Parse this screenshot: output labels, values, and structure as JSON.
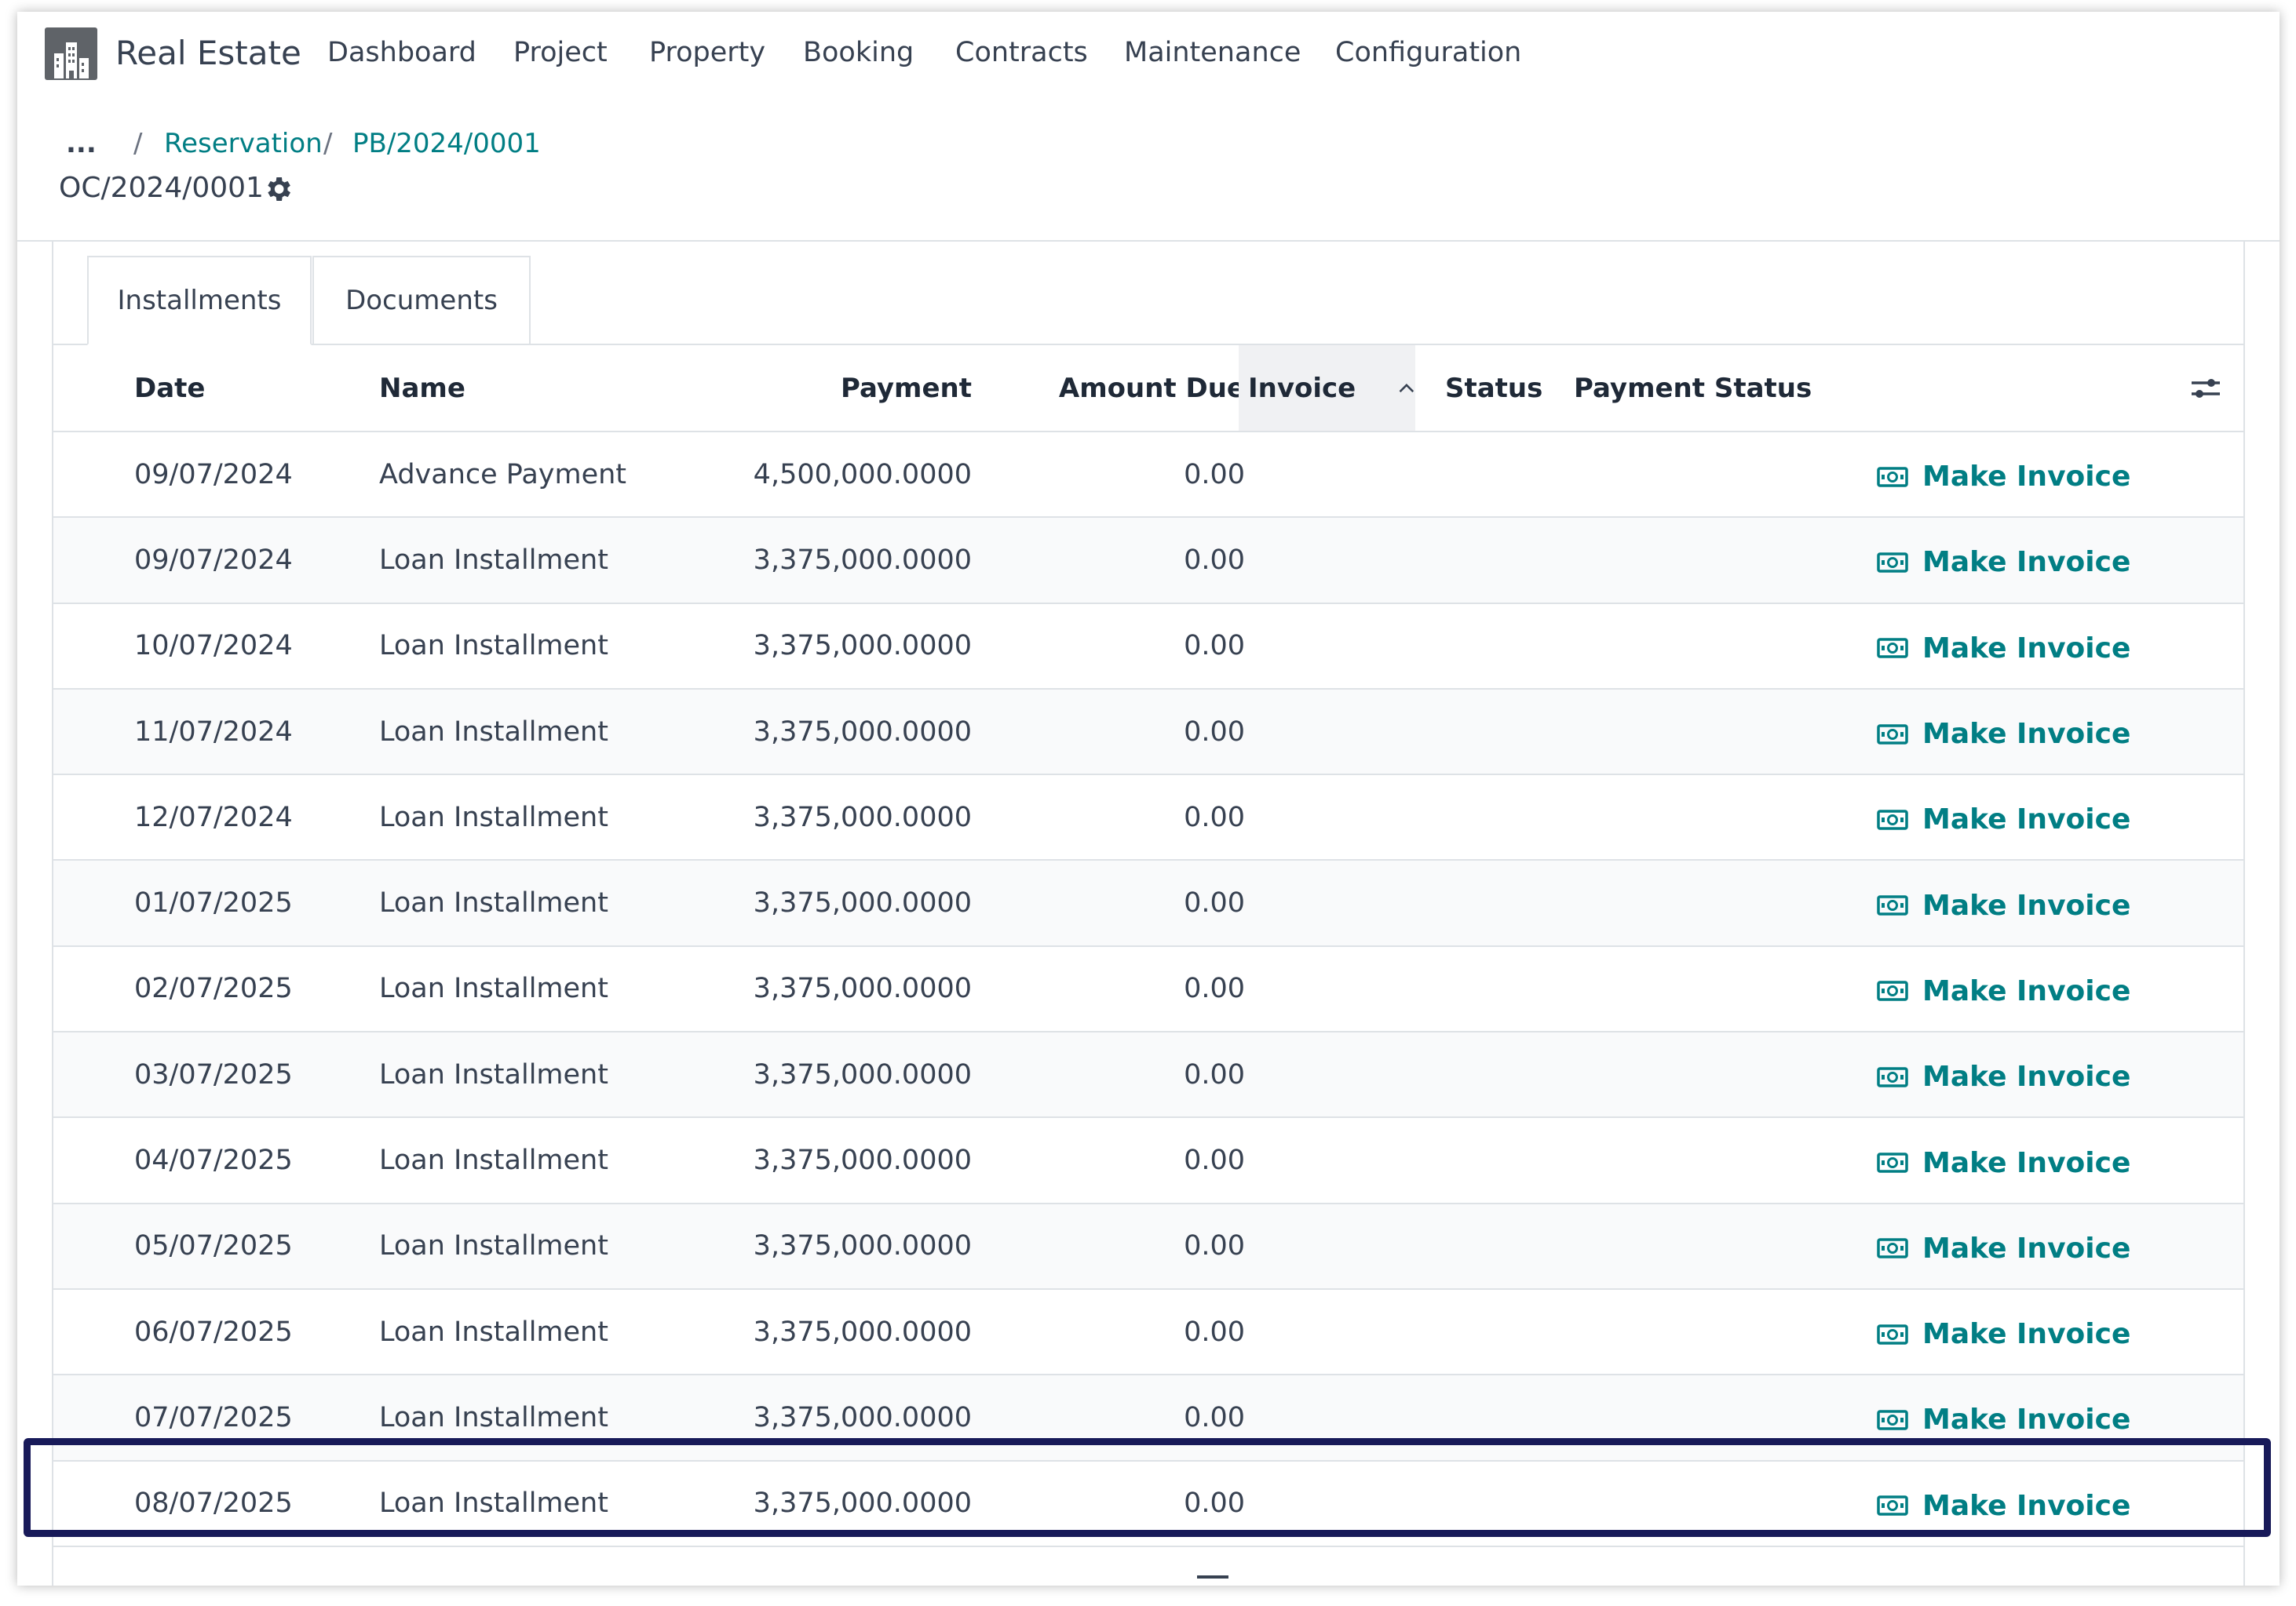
{
  "navbar": {
    "app_name": "Real Estate",
    "menu": [
      "Dashboard",
      "Project",
      "Property",
      "Booking",
      "Contracts",
      "Maintenance",
      "Configuration"
    ]
  },
  "breadcrumb": {
    "ellipsis": "...",
    "separator": "/",
    "items": [
      "Reservation",
      "PB/2024/0001"
    ]
  },
  "record": {
    "title": "OC/2024/0001"
  },
  "tabs": [
    "Installments",
    "Documents"
  ],
  "table": {
    "columns": [
      "Date",
      "Name",
      "Payment",
      "Amount Due",
      "Invoice",
      "Status",
      "Payment Status"
    ],
    "sorted_column": "Invoice",
    "action_label": "Make Invoice",
    "rows": [
      {
        "date": "09/07/2024",
        "name": "Advance Payment",
        "payment": "4,500,000.0000",
        "amount_due": "0.00"
      },
      {
        "date": "09/07/2024",
        "name": "Loan Installment",
        "payment": "3,375,000.0000",
        "amount_due": "0.00"
      },
      {
        "date": "10/07/2024",
        "name": "Loan Installment",
        "payment": "3,375,000.0000",
        "amount_due": "0.00"
      },
      {
        "date": "11/07/2024",
        "name": "Loan Installment",
        "payment": "3,375,000.0000",
        "amount_due": "0.00"
      },
      {
        "date": "12/07/2024",
        "name": "Loan Installment",
        "payment": "3,375,000.0000",
        "amount_due": "0.00"
      },
      {
        "date": "01/07/2025",
        "name": "Loan Installment",
        "payment": "3,375,000.0000",
        "amount_due": "0.00"
      },
      {
        "date": "02/07/2025",
        "name": "Loan Installment",
        "payment": "3,375,000.0000",
        "amount_due": "0.00"
      },
      {
        "date": "03/07/2025",
        "name": "Loan Installment",
        "payment": "3,375,000.0000",
        "amount_due": "0.00"
      },
      {
        "date": "04/07/2025",
        "name": "Loan Installment",
        "payment": "3,375,000.0000",
        "amount_due": "0.00"
      },
      {
        "date": "05/07/2025",
        "name": "Loan Installment",
        "payment": "3,375,000.0000",
        "amount_due": "0.00"
      },
      {
        "date": "06/07/2025",
        "name": "Loan Installment",
        "payment": "3,375,000.0000",
        "amount_due": "0.00"
      },
      {
        "date": "07/07/2025",
        "name": "Loan Installment",
        "payment": "3,375,000.0000",
        "amount_due": "0.00"
      },
      {
        "date": "08/07/2025",
        "name": "Loan Installment",
        "payment": "3,375,000.0000",
        "amount_due": "0.00"
      }
    ]
  },
  "colors": {
    "link": "#017e84",
    "highlight": "#181a59",
    "text": "#374151"
  },
  "icons": {
    "app_logo": "building-icon",
    "settings": "gear-icon",
    "action": "money-icon",
    "optional_columns": "sliders-icon",
    "sort": "chevron-up-icon"
  }
}
